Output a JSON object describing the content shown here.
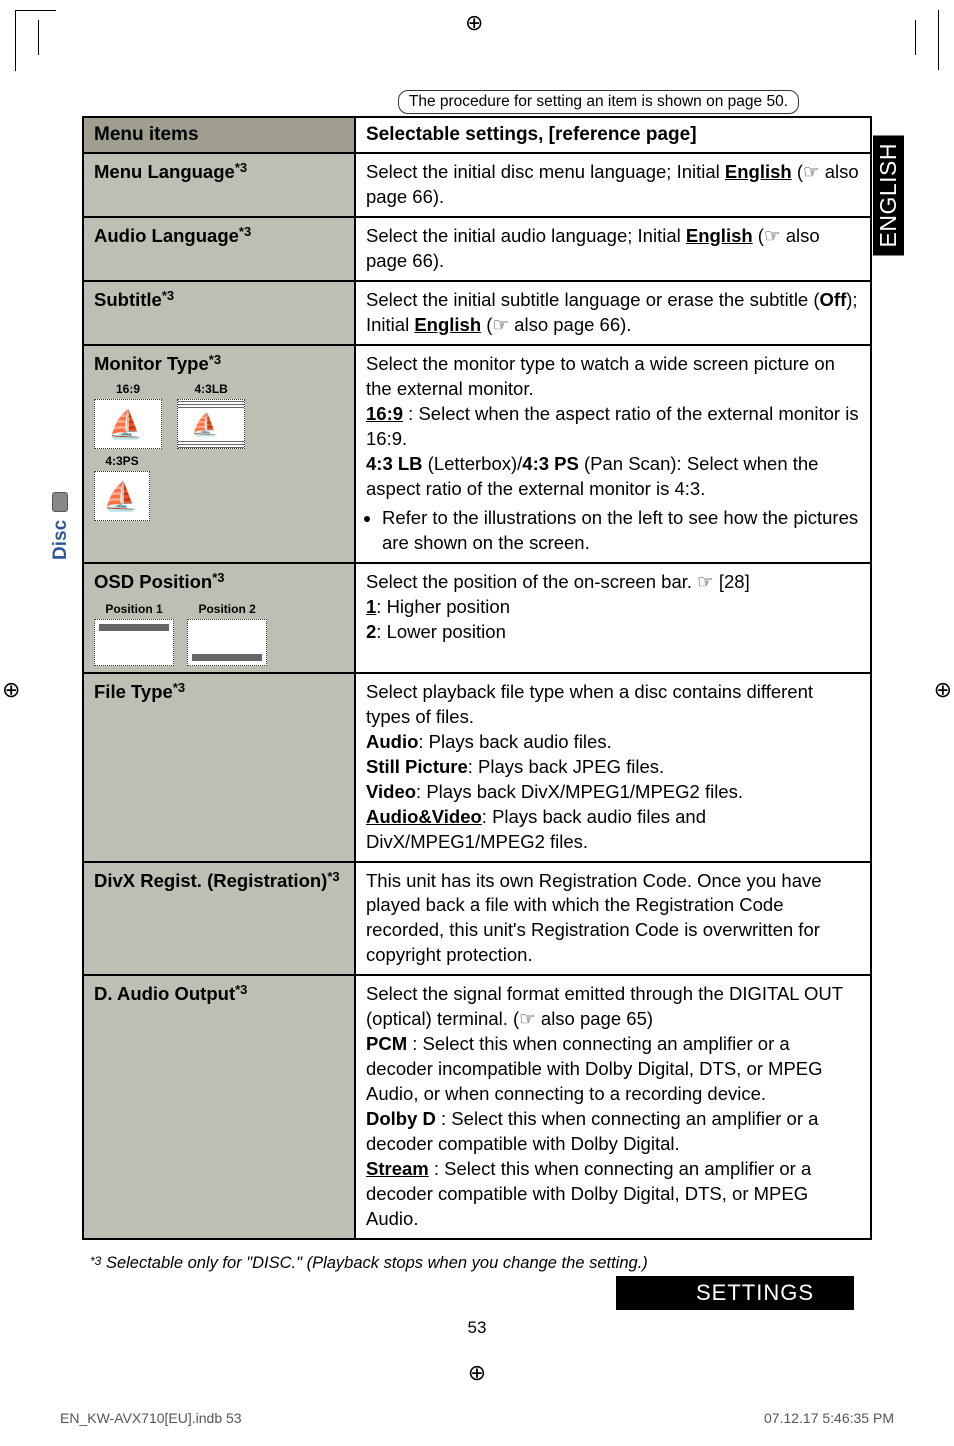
{
  "procedure_note": "The procedure for setting an item is shown on page 50.",
  "side_tab": "ENGLISH",
  "side_label": "Disc",
  "header": {
    "col1": "Menu items",
    "col2": "Selectable settings, [reference page]"
  },
  "rows": {
    "menu_lang": {
      "title": "Menu Language",
      "sup": "*3",
      "desc_pre": "Select the initial disc menu language; Initial ",
      "key": "English",
      "desc_post": " (☞ also page 66)."
    },
    "audio_lang": {
      "title": "Audio Language",
      "sup": "*3",
      "desc_pre": "Select the initial audio language; Initial ",
      "key": "English",
      "desc_post": " (☞ also page 66)."
    },
    "subtitle": {
      "title": "Subtitle",
      "sup": "*3",
      "line1_pre": "Select the initial subtitle language or erase the subtitle (",
      "line1_bold": "Off",
      "line1_post": "); Initial ",
      "line2_key": "English",
      "line2_post": " (☞ also page 66)."
    },
    "monitor": {
      "title": "Monitor Type",
      "sup": "*3",
      "label_169": "16:9",
      "label_43lb": "4:3LB",
      "label_43ps": "4:3PS",
      "desc1": "Select the monitor type to watch a wide screen picture on the external monitor.",
      "key169": "16:9",
      "key169_text": " : Select when the aspect ratio of the external monitor is 16:9.",
      "lb_label": "4:3 LB",
      "lb_mid": " (Letterbox)/",
      "ps_label": "4:3 PS",
      "lb_text": " (Pan Scan): Select when the aspect ratio of the external monitor is 4:3.",
      "bullet": "Refer to the illustrations on the left to see how the pictures are shown on the screen."
    },
    "osd": {
      "title": "OSD Position",
      "sup": "*3",
      "pos1": "Position 1",
      "pos2": "Position 2",
      "desc": "Select the position of the on-screen bar. ☞ [28]",
      "opt1_key": "1",
      "opt1_text": ": Higher position",
      "opt2_key": "2",
      "opt2_text": ": Lower position"
    },
    "filetype": {
      "title": "File Type",
      "sup": "*3",
      "desc1": "Select playback file type when a disc contains different types of files.",
      "audio_label": "Audio",
      "audio_text": ": Plays back audio files.",
      "still_label": "Still Picture",
      "still_text": ": Plays back JPEG files.",
      "video_label": "Video",
      "video_text": ": Plays back DivX/MPEG1/MPEG2 files.",
      "av_key": "Audio&Video",
      "av_text": ": Plays back audio files and DivX/MPEG1/MPEG2 files."
    },
    "divx": {
      "title": "DivX Regist. (Registration)",
      "sup": "*3",
      "desc": "This unit has its own Registration Code. Once you have played back a file with which the Registration Code recorded, this unit's Registration Code is overwritten for copyright protection."
    },
    "daudio": {
      "title": "D. Audio Output",
      "sup": "*3",
      "desc1": "Select the signal format emitted through the DIGITAL OUT (optical) terminal. (☞ also page 65)",
      "pcm_label": "PCM",
      "pcm_text": " : Select this when connecting an amplifier or a decoder incompatible with Dolby Digital, DTS, or MPEG Audio, or when connecting to a recording device.",
      "dolby_label": "Dolby D",
      "dolby_text": " : Select this when connecting an amplifier or a decoder compatible with Dolby Digital.",
      "stream_key": "Stream",
      "stream_text": " : Select this when connecting an amplifier or a decoder compatible with Dolby Digital, DTS, or MPEG Audio."
    }
  },
  "footnote": {
    "sup": "*3",
    "text": "Selectable only for \"DISC.\" (Playback stops when you change the setting.)"
  },
  "page_number": "53",
  "section_label": "SETTINGS",
  "footer": {
    "left": "EN_KW-AVX710[EU].indb   53",
    "right": "07.12.17   5:46:35 PM"
  }
}
